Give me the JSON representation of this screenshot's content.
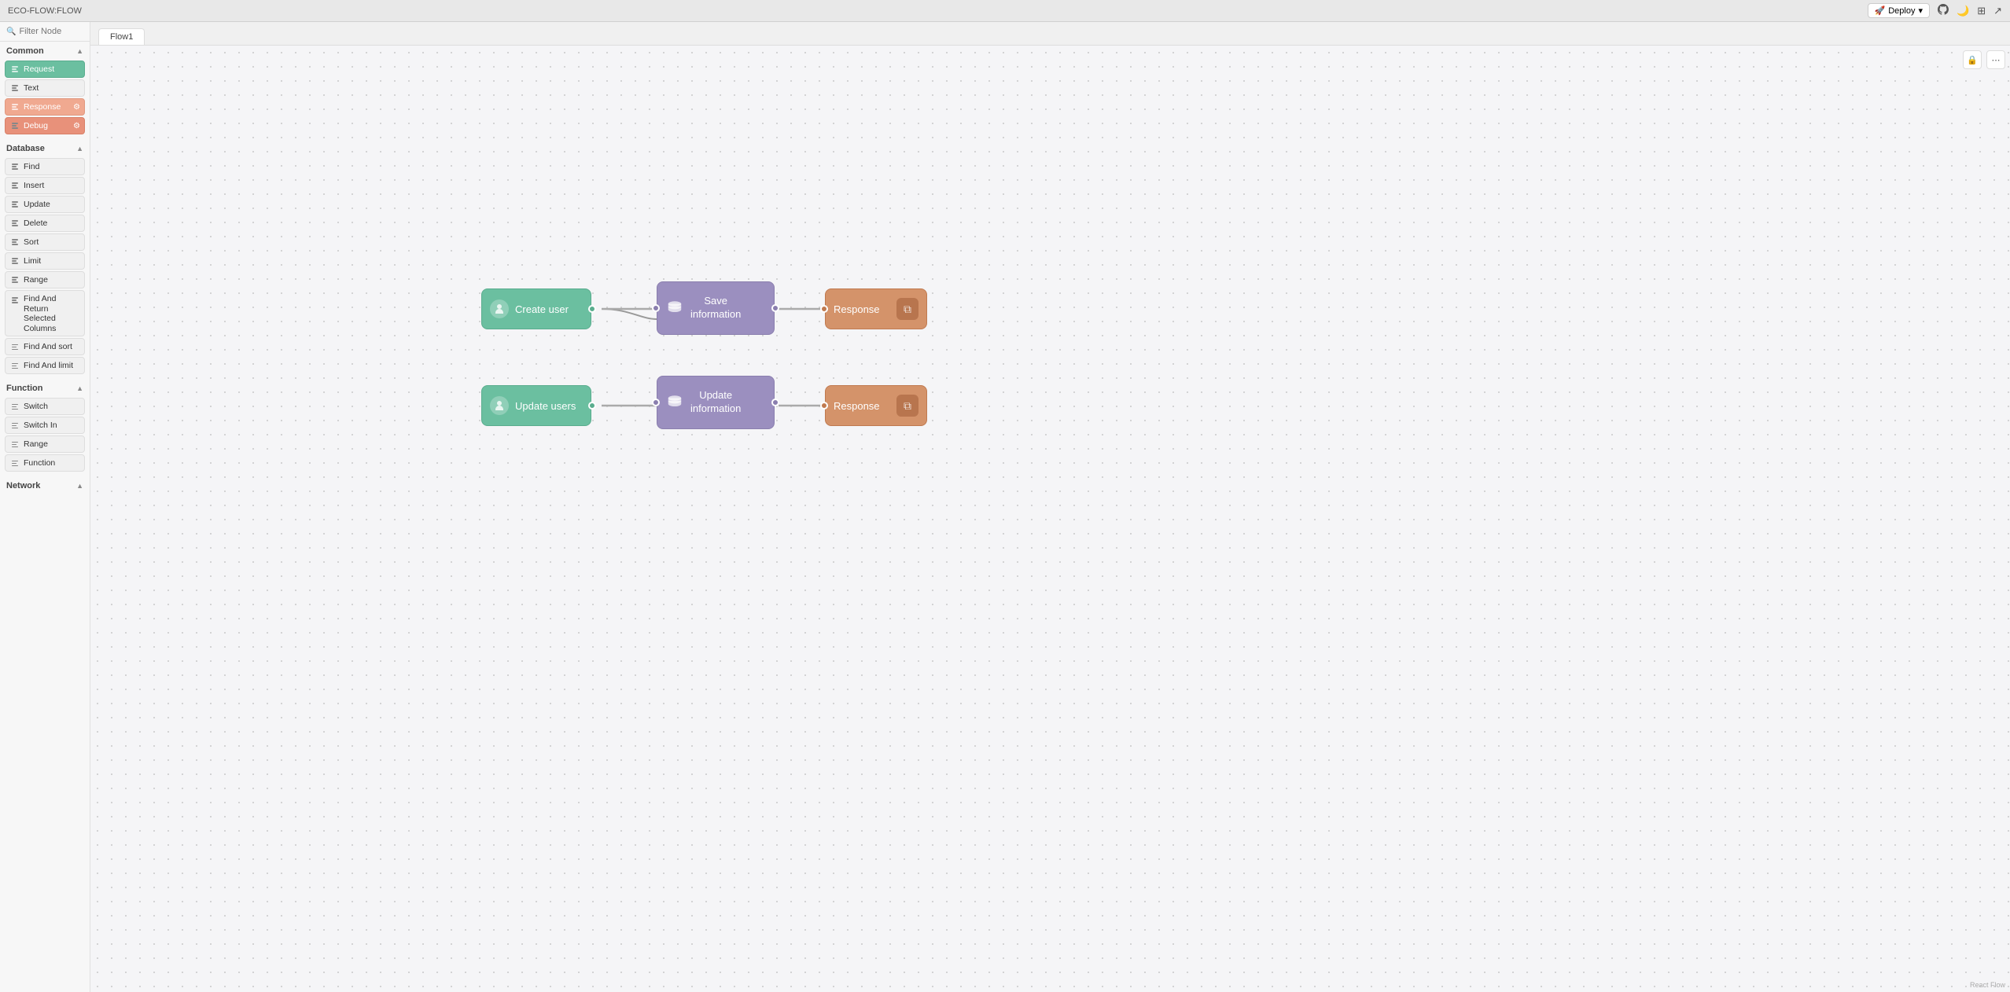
{
  "topbar": {
    "title": "ECO-FLOW:FLOW",
    "deploy_label": "Deploy",
    "icons": [
      "rocket-icon",
      "github-icon",
      "moon-icon",
      "grid-icon",
      "arrow-right-icon"
    ]
  },
  "sidebar": {
    "search_placeholder": "Filter Node",
    "sections": [
      {
        "id": "common",
        "label": "Common",
        "items": [
          {
            "id": "request",
            "label": "Request",
            "style": "green"
          },
          {
            "id": "text",
            "label": "Text",
            "style": "gray"
          },
          {
            "id": "response",
            "label": "Response",
            "style": "salmon"
          },
          {
            "id": "debug",
            "label": "Debug",
            "style": "salmon2"
          }
        ]
      },
      {
        "id": "database",
        "label": "Database",
        "items": [
          {
            "id": "find",
            "label": "Find",
            "style": "gray"
          },
          {
            "id": "insert",
            "label": "Insert",
            "style": "gray"
          },
          {
            "id": "update",
            "label": "Update",
            "style": "gray"
          },
          {
            "id": "delete",
            "label": "Delete",
            "style": "gray"
          },
          {
            "id": "sort",
            "label": "Sort",
            "style": "gray"
          },
          {
            "id": "limit",
            "label": "Limit",
            "style": "gray"
          },
          {
            "id": "range",
            "label": "Range",
            "style": "gray"
          },
          {
            "id": "find-return",
            "label": "Find And Return Selected Columns",
            "style": "gray"
          },
          {
            "id": "find-sort",
            "label": "Find And sort",
            "style": "gray"
          },
          {
            "id": "find-limit",
            "label": "Find And limit",
            "style": "gray"
          }
        ]
      },
      {
        "id": "function",
        "label": "Function",
        "items": [
          {
            "id": "switch",
            "label": "Switch",
            "style": "gray"
          },
          {
            "id": "switch-in",
            "label": "Switch In",
            "style": "gray"
          },
          {
            "id": "range2",
            "label": "Range",
            "style": "gray"
          },
          {
            "id": "function",
            "label": "Function",
            "style": "gray"
          }
        ]
      },
      {
        "id": "network",
        "label": "Network",
        "items": []
      }
    ]
  },
  "tabs": [
    {
      "id": "flow1",
      "label": "Flow1"
    }
  ],
  "flow_nodes": {
    "row1": {
      "create_user": {
        "label": "Create user",
        "type": "green"
      },
      "save_info": {
        "label": "Save\ninformation",
        "type": "purple"
      },
      "response1": {
        "label": "Response",
        "type": "salmon"
      }
    },
    "row2": {
      "update_users": {
        "label": "Update users",
        "type": "green"
      },
      "update_info": {
        "label": "Update\ninformation",
        "type": "purple"
      },
      "response2": {
        "label": "Response",
        "type": "salmon"
      }
    }
  },
  "react_flow_label": "React Flow"
}
